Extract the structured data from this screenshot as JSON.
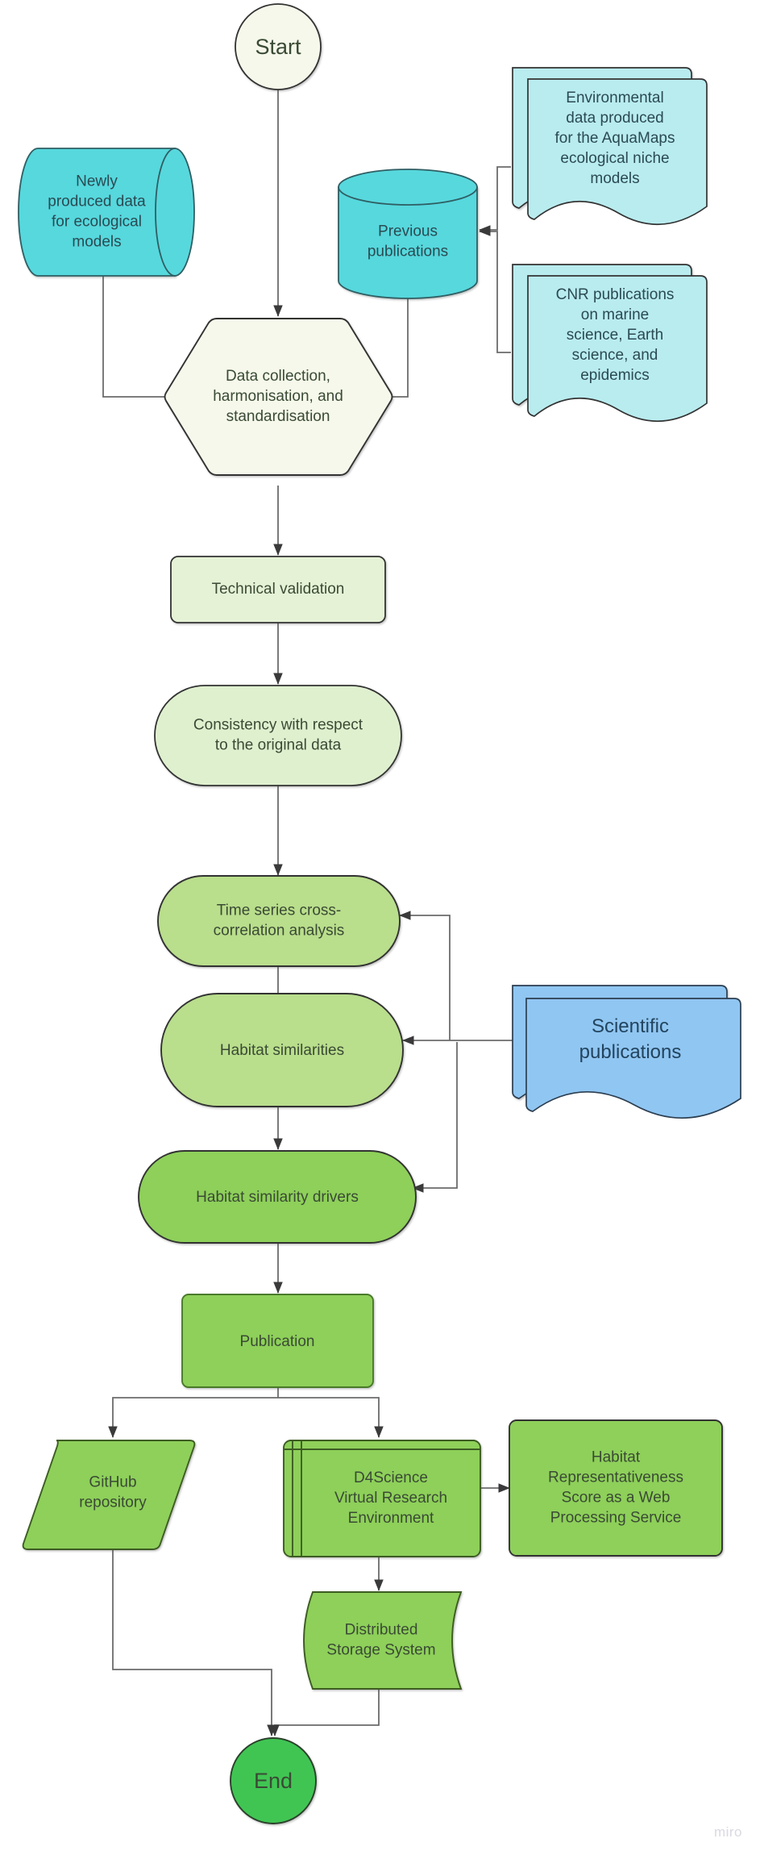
{
  "board": {
    "watermark": "miro",
    "colors": {
      "cream": "#f5f8ea",
      "pale_green": "#dff0cf",
      "mid_green": "#c2e39b",
      "green": "#8ed05a",
      "bright_green": "#3fc553",
      "cyan": "#57d8dd",
      "pale_cyan": "#b9ecef",
      "blue": "#90c6f2",
      "stroke": "#333333",
      "connector": "#6b6b6b",
      "text_green": "#3a4a34",
      "text_cyan": "#2b4a52",
      "text_blue": "#23445e"
    }
  },
  "nodes": {
    "start": {
      "label": "Start",
      "shape": "circle"
    },
    "newly_produced": {
      "label": "Newly\nproduced data\nfor ecological\nmodels",
      "shape": "cylinder-horizontal"
    },
    "previous_publications": {
      "label": "Previous\npublications",
      "shape": "cylinder-vertical"
    },
    "environmental_data": {
      "label": "Environmental\ndata produced\nfor the AquaMaps\necological niche\nmodels",
      "shape": "multi-document"
    },
    "cnr_publications": {
      "label": "CNR publications\non marine\nscience, Earth\nscience, and\nepidemics",
      "shape": "multi-document"
    },
    "data_collection": {
      "label": "Data collection,\nharmonisation, and\nstandardisation",
      "shape": "hexagon"
    },
    "technical_validation": {
      "label": "Technical validation",
      "shape": "rounded-rect"
    },
    "consistency": {
      "label": "Consistency with respect\nto the original data",
      "shape": "stadium"
    },
    "time_series": {
      "label": "Time series cross-\ncorrelation analysis",
      "shape": "stadium"
    },
    "habitat_similarities": {
      "label": "Habitat similarities",
      "shape": "stadium"
    },
    "scientific_publications": {
      "label": "Scientific\npublications",
      "shape": "multi-document"
    },
    "habitat_similarity_drivers": {
      "label": "Habitat similarity drivers",
      "shape": "stadium"
    },
    "publication": {
      "label": "Publication",
      "shape": "rounded-rect"
    },
    "github_repository": {
      "label": "GitHub\nrepository",
      "shape": "parallelogram"
    },
    "d4science_vre": {
      "label": "D4Science\nVirtual Research\nEnvironment",
      "shape": "predefined-process"
    },
    "habitat_representativeness": {
      "label": "Habitat\nRepresentativeness\nScore as  a Web\nProcessing Service",
      "shape": "rounded-rect"
    },
    "distributed_storage": {
      "label": "Distributed\nStorage System",
      "shape": "direct-data"
    },
    "end": {
      "label": "End",
      "shape": "circle"
    }
  },
  "edges": [
    {
      "from": "start",
      "to": "data_collection"
    },
    {
      "from": "newly_produced",
      "to": "data_collection"
    },
    {
      "from": "previous_publications",
      "to": "data_collection"
    },
    {
      "from": "environmental_data",
      "to": "previous_publications"
    },
    {
      "from": "cnr_publications",
      "to": "previous_publications"
    },
    {
      "from": "data_collection",
      "to": "technical_validation"
    },
    {
      "from": "technical_validation",
      "to": "consistency"
    },
    {
      "from": "consistency",
      "to": "time_series"
    },
    {
      "from": "time_series",
      "to": "habitat_similarities"
    },
    {
      "from": "habitat_similarities",
      "to": "habitat_similarity_drivers"
    },
    {
      "from": "scientific_publications",
      "to": "time_series"
    },
    {
      "from": "scientific_publications",
      "to": "habitat_similarities"
    },
    {
      "from": "scientific_publications",
      "to": "habitat_similarity_drivers"
    },
    {
      "from": "habitat_similarity_drivers",
      "to": "publication"
    },
    {
      "from": "publication",
      "to": "github_repository"
    },
    {
      "from": "publication",
      "to": "d4science_vre"
    },
    {
      "from": "d4science_vre",
      "to": "habitat_representativeness"
    },
    {
      "from": "d4science_vre",
      "to": "distributed_storage"
    },
    {
      "from": "github_repository",
      "to": "end"
    },
    {
      "from": "distributed_storage",
      "to": "end"
    }
  ]
}
